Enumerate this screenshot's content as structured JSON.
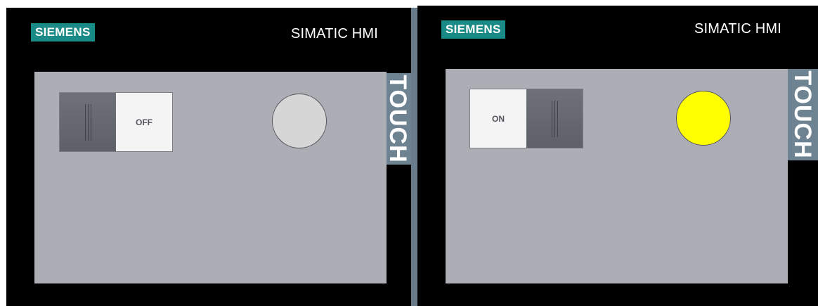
{
  "panels": [
    {
      "brand": "SIEMENS",
      "product": "SIMATIC HMI",
      "side_label": "TOUCH",
      "switch": {
        "state": "off",
        "label": "OFF"
      },
      "lamp": {
        "on": false,
        "color": "#d6d6d6"
      }
    },
    {
      "brand": "SIEMENS",
      "product": "SIMATIC HMI",
      "side_label": "TOUCH",
      "switch": {
        "state": "on",
        "label": "ON"
      },
      "lamp": {
        "on": true,
        "color": "#ffff00"
      }
    }
  ],
  "colors": {
    "brand_teal": "#1a8a86",
    "screen_gray": "#acadb5",
    "bezel": "#000000",
    "touch_band": "#6e8392",
    "switch_dark": "#62646e",
    "switch_light": "#f4f4f4"
  }
}
